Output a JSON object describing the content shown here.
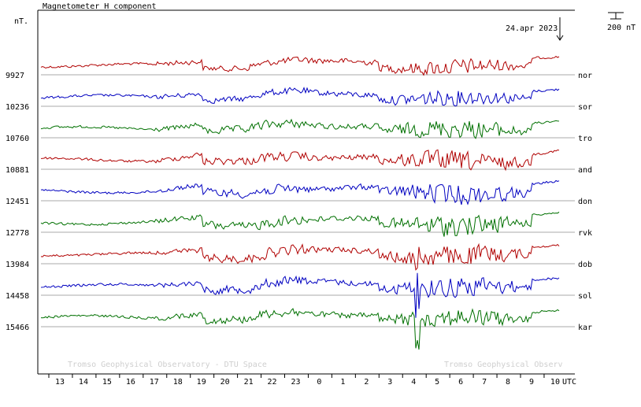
{
  "chart_data": {
    "type": "line",
    "title": "Magnetometer H component",
    "ylabel": "nT.",
    "date_label": "24.apr 2023",
    "scale_label": "200 nT",
    "x_axis_unit": "UTC",
    "x_tick_labels": [
      "13",
      "14",
      "15",
      "16",
      "17",
      "18",
      "19",
      "20",
      "21",
      "22",
      "23",
      "0",
      "1",
      "2",
      "3",
      "4",
      "5",
      "6",
      "7",
      "8",
      "9",
      "10"
    ],
    "event_hour_index": 21.1,
    "watermark_left": "Tromso Geophysical Observatory - DTU Space",
    "watermark_right": "Tromso Geophysical Observ",
    "grid": "horizontal baselines",
    "series": [
      {
        "name": "nor",
        "baseline": "9927",
        "color": "#b00000",
        "disturbance": 0.55,
        "spike": 0
      },
      {
        "name": "sor",
        "baseline": "10236",
        "color": "#0000c0",
        "disturbance": 0.6,
        "spike": 0
      },
      {
        "name": "tro",
        "baseline": "10760",
        "color": "#007000",
        "disturbance": 0.75,
        "spike": 0
      },
      {
        "name": "and",
        "baseline": "10881",
        "color": "#b00000",
        "disturbance": 0.8,
        "spike": 0
      },
      {
        "name": "don",
        "baseline": "12451",
        "color": "#0000c0",
        "disturbance": 0.85,
        "spike": 0
      },
      {
        "name": "rvk",
        "baseline": "12778",
        "color": "#007000",
        "disturbance": 0.9,
        "spike": 0
      },
      {
        "name": "dob",
        "baseline": "13984",
        "color": "#b00000",
        "disturbance": 0.9,
        "spike": 0.6
      },
      {
        "name": "sol",
        "baseline": "14458",
        "color": "#0000c0",
        "disturbance": 0.85,
        "spike": 0.8
      },
      {
        "name": "kar",
        "baseline": "15466",
        "color": "#007000",
        "disturbance": 0.8,
        "spike": 1.0
      }
    ]
  }
}
